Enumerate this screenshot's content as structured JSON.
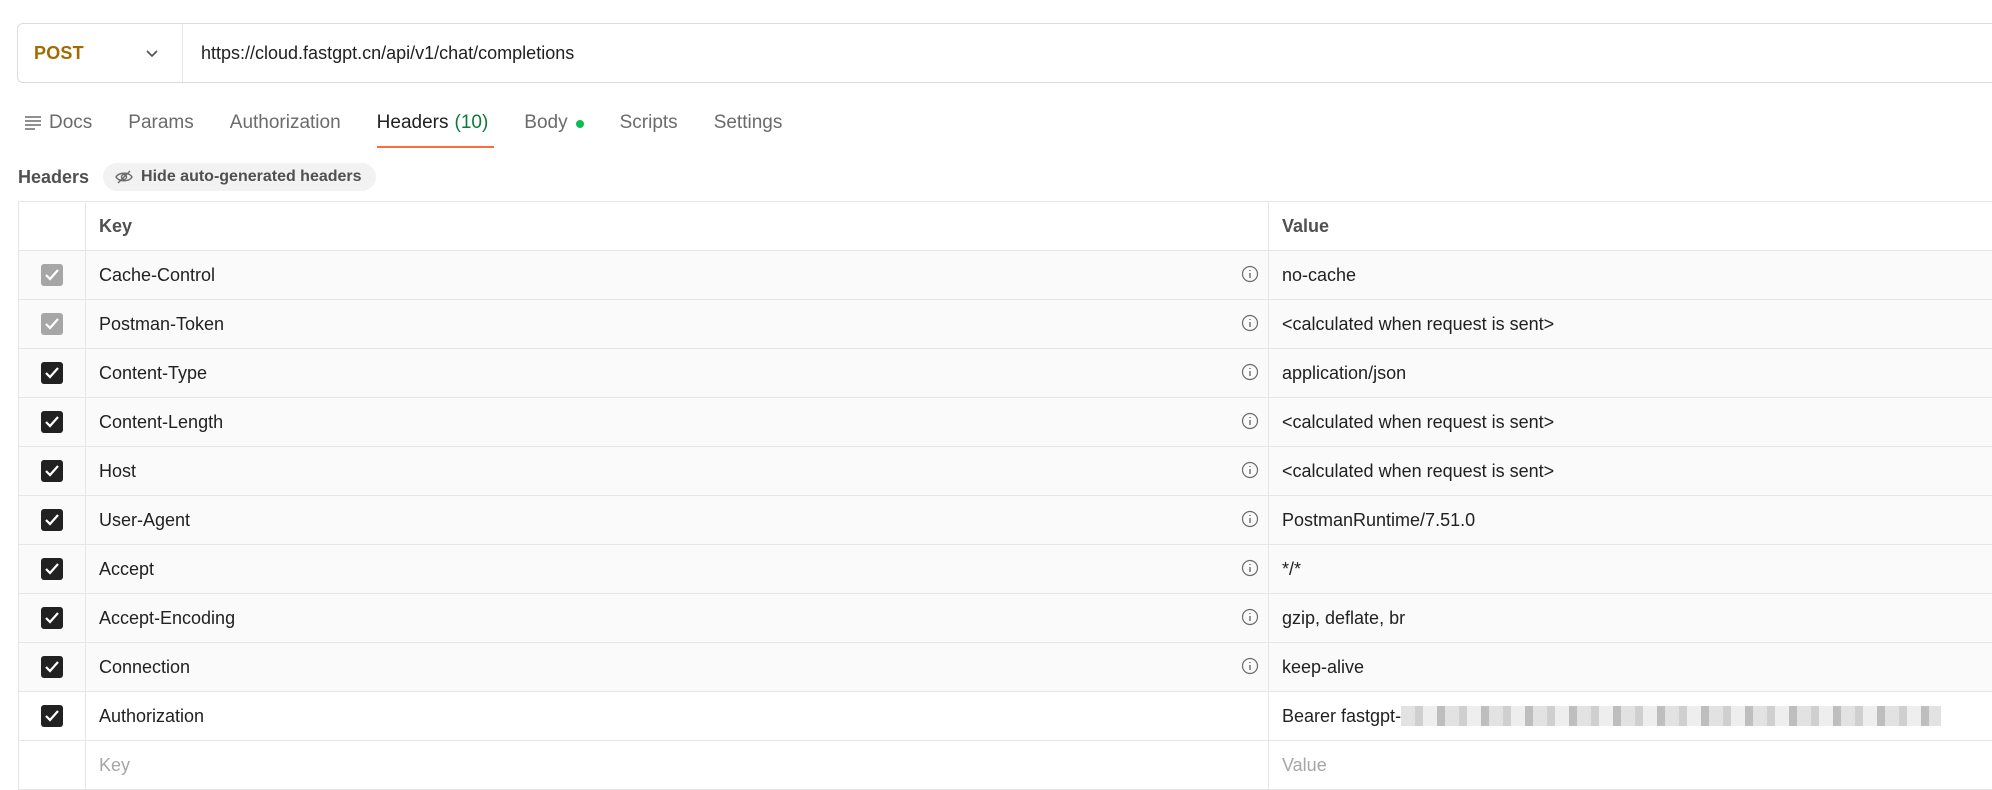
{
  "request": {
    "method": "POST",
    "url": "https://cloud.fastgpt.cn/api/v1/chat/completions"
  },
  "tabs": [
    {
      "label": "Docs",
      "icon": "docs-icon"
    },
    {
      "label": "Params"
    },
    {
      "label": "Authorization"
    },
    {
      "label": "Headers",
      "count": "(10)",
      "active": true
    },
    {
      "label": "Body",
      "indicator": "dot"
    },
    {
      "label": "Scripts"
    },
    {
      "label": "Settings"
    }
  ],
  "headers_section": {
    "title": "Headers",
    "toggle_label": "Hide auto-generated headers"
  },
  "table": {
    "key_header": "Key",
    "value_header": "Value",
    "rows": [
      {
        "key": "Cache-Control",
        "value": "no-cache",
        "checked": true,
        "auto": true
      },
      {
        "key": "Postman-Token",
        "value": "<calculated when request is sent>",
        "checked": true,
        "auto": true
      },
      {
        "key": "Content-Type",
        "value": "application/json",
        "checked": true,
        "auto": true
      },
      {
        "key": "Content-Length",
        "value": "<calculated when request is sent>",
        "checked": true,
        "auto": true
      },
      {
        "key": "Host",
        "value": "<calculated when request is sent>",
        "checked": true,
        "auto": true
      },
      {
        "key": "User-Agent",
        "value": "PostmanRuntime/7.51.0",
        "checked": true,
        "auto": true
      },
      {
        "key": "Accept",
        "value": "*/*",
        "checked": true,
        "auto": true
      },
      {
        "key": "Accept-Encoding",
        "value": "gzip, deflate, br",
        "checked": true,
        "auto": true
      },
      {
        "key": "Connection",
        "value": "keep-alive",
        "checked": true,
        "auto": true
      },
      {
        "key": "Authorization",
        "value": "Bearer fastgpt-",
        "checked": true,
        "auto": false,
        "redacted": true
      }
    ],
    "new_row": {
      "key_placeholder": "Key",
      "value_placeholder": "Value"
    }
  },
  "colors": {
    "method": "#a06b00",
    "active_tab_underline": "#ff6c37",
    "count": "#0c7a3a",
    "body_dot": "#0cbb52"
  }
}
